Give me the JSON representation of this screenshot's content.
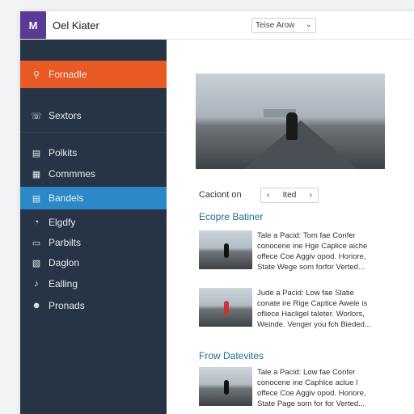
{
  "app": {
    "logo": "M",
    "title": "Oel Kiater"
  },
  "topbar": {
    "select_value": "Teise Arow",
    "caret": "⌄"
  },
  "sidebar": {
    "items": [
      {
        "label": "Fornadle",
        "icon": "⚲"
      },
      {
        "label": "Sextors",
        "icon": "☏"
      },
      {
        "label": "Polkits",
        "icon": "▤"
      },
      {
        "label": "Commmes",
        "icon": "▦"
      },
      {
        "label": "Bandels",
        "icon": "▤"
      },
      {
        "label": "Elgdfy",
        "icon": "◔"
      },
      {
        "label": "Parbilts",
        "icon": "▭"
      },
      {
        "label": "Daglon",
        "icon": "▧"
      },
      {
        "label": "Ealling",
        "icon": "♪"
      },
      {
        "label": "Pronads",
        "icon": "☻"
      }
    ]
  },
  "main": {
    "caption_label": "Caciont on",
    "pager": {
      "prev": "‹",
      "label": "Ited",
      "next": "›"
    },
    "sections": [
      {
        "title": "Ecopre Batiner",
        "articles": [
          {
            "lines": [
              "Tale a Pacid: Tom fae Confer",
              "conocene ine Hge Caplice aiche",
              "offece Coe Aggiv opod. Horiore,",
              "State Wege som forfor Verted..."
            ]
          },
          {
            "lines": [
              "Jude a Pacid: Low fae Slatie",
              "conate ire Rige Captice Awele is",
              "ofliece Hacligel taleter. Worlors,",
              "Weinde. Venger you fch Bieded..."
            ]
          }
        ]
      },
      {
        "title": "Frow Datevites",
        "articles": [
          {
            "lines": [
              "Tale a Pacid: Low fae Confer",
              "conocene ine Caphlce aclue I",
              "offece Coe Aggiv opod. Horiore,",
              "State Page som for for Verted..."
            ]
          }
        ]
      }
    ]
  },
  "colors": {
    "sidebar": "#263445",
    "accent_orange": "#ea5a25",
    "accent_blue": "#2d88c8",
    "link_teal": "#1f6c91",
    "logo_purple": "#5b3a94"
  }
}
